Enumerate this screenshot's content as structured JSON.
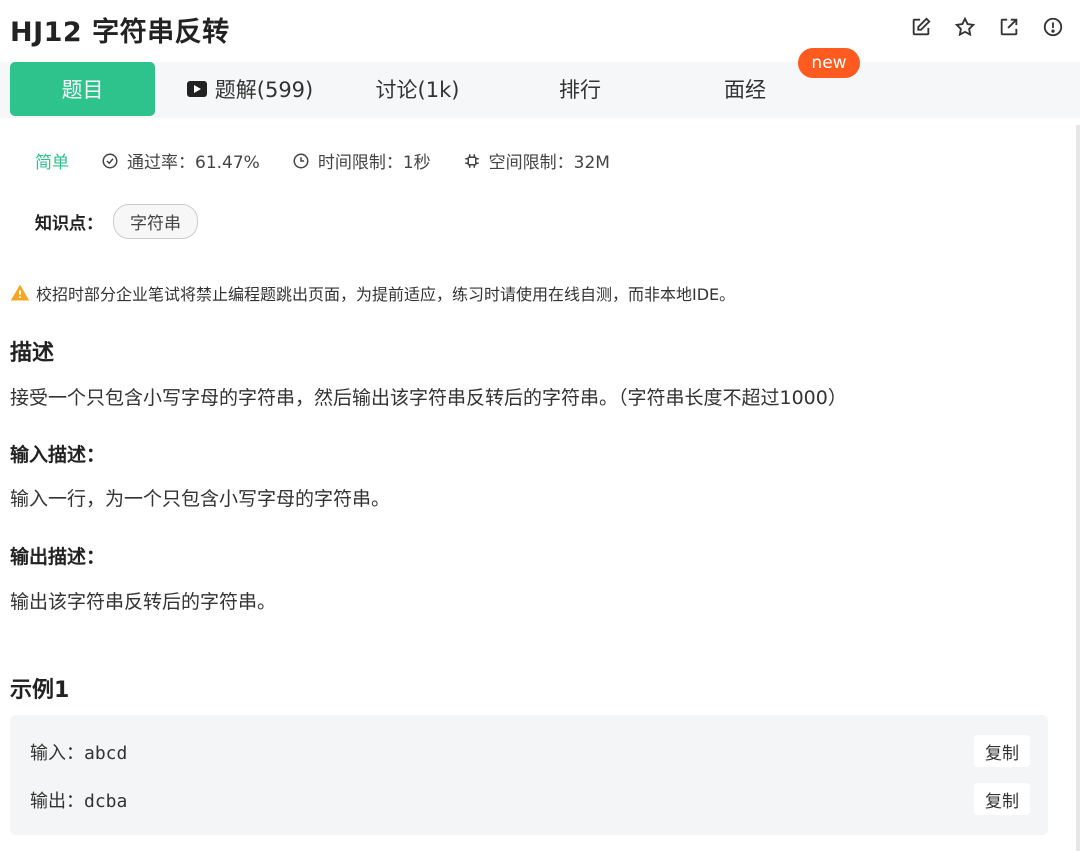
{
  "problem": {
    "title": "HJ12  字符串反转"
  },
  "tabs": [
    {
      "label": "题目",
      "active": true
    },
    {
      "label": "题解(599)"
    },
    {
      "label": "讨论(1k)"
    },
    {
      "label": "排行"
    },
    {
      "label": "面经"
    }
  ],
  "new_badge": "new",
  "meta": {
    "difficulty": "简单",
    "pass_rate": "通过率：61.47%",
    "time_limit": "时间限制：1秒",
    "space_limit": "空间限制：32M"
  },
  "knowledge": {
    "label": "知识点：",
    "tag": "字符串"
  },
  "warning": "校招时部分企业笔试将禁止编程题跳出页面，为提前适应，练习时请使用在线自测，而非本地IDE。",
  "description": {
    "heading": "描述",
    "text": "接受一个只包含小写字母的字符串，然后输出该字符串反转后的字符串。（字符串长度不超过1000）"
  },
  "input_desc": {
    "heading": "输入描述：",
    "text": "输入一行，为一个只包含小写字母的字符串。"
  },
  "output_desc": {
    "heading": "输出描述：",
    "text": "输出该字符串反转后的字符串。"
  },
  "example": {
    "heading": "示例1",
    "input_label": "输入：",
    "input_value": "abcd",
    "output_label": "输出：",
    "output_value": "dcba",
    "copy_label": "复制"
  },
  "icons": [
    "edit-icon",
    "star-icon",
    "share-icon",
    "report-icon"
  ],
  "colors": {
    "accent": "#2ec28c",
    "new_badge": "#ff5a1f",
    "warning": "#f5a623"
  }
}
